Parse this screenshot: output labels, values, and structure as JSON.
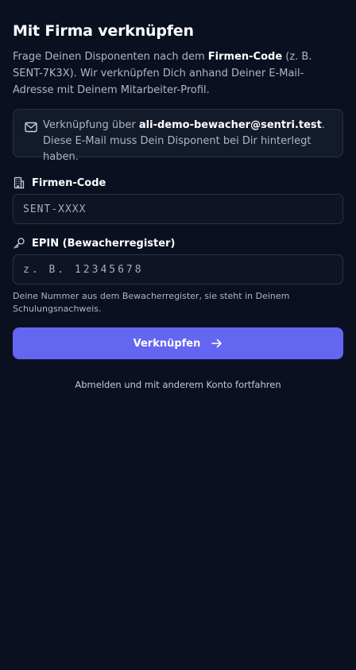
{
  "header": {
    "title": "Mit Firma verknüpfen"
  },
  "intro": {
    "part1": "Frage Deinen Disponenten nach dem ",
    "highlight": "Firmen-Code",
    "part2": " (z. B. SENT-7K3X). Wir verknüpfen Dich anhand Deiner E-Mail-Adresse mit Deinem Mitarbeiter-Profil."
  },
  "notice": {
    "icon": "mail-icon",
    "prefix": "Verknüpfung über ",
    "email": "ali-demo-bewacher@sentri.test",
    "suffix": ". Diese E-Mail muss Dein Disponent bei Dir hinterlegt haben."
  },
  "company_code": {
    "icon": "building-icon",
    "label": "Firmen-Code",
    "value": "",
    "placeholder": "SENT-XXXX"
  },
  "epin": {
    "icon": "key-icon",
    "label": "EPIN (Bewacherregister)",
    "value": "",
    "placeholder": "z. B. 12345678",
    "help": "Deine Nummer aus dem Bewacherregister, sie steht in Deinem Schulungsnachweis."
  },
  "submit": {
    "label": "Verknüpfen",
    "icon": "arrow-right-icon"
  },
  "footer": {
    "logout_label": "Abmelden und mit anderem Konto fortfahren"
  },
  "colors": {
    "background": "#0b1020",
    "accent": "#6366f1",
    "card": "#131a2a"
  }
}
